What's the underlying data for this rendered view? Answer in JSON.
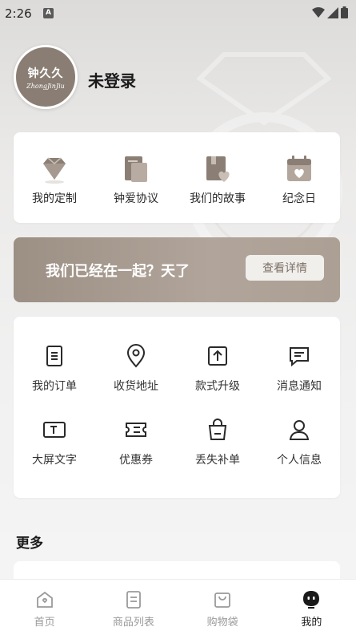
{
  "status_bar": {
    "time": "2:26",
    "notification_letter": "A"
  },
  "profile": {
    "avatar_cn": "钟久久",
    "avatar_en": "ZhongJinJiu",
    "login_label": "未登录"
  },
  "top_menu": [
    {
      "label": "我的定制",
      "icon": "diamond-icon"
    },
    {
      "label": "钟爱协议",
      "icon": "document-icon"
    },
    {
      "label": "我们的故事",
      "icon": "book-heart-icon"
    },
    {
      "label": "纪念日",
      "icon": "calendar-heart-icon"
    }
  ],
  "banner": {
    "text": "我们已经在一起？天了",
    "button": "查看详情"
  },
  "services": [
    {
      "label": "我的订单",
      "icon": "order-icon"
    },
    {
      "label": "收货地址",
      "icon": "location-pin-icon"
    },
    {
      "label": "款式升级",
      "icon": "upgrade-icon"
    },
    {
      "label": "消息通知",
      "icon": "message-icon"
    },
    {
      "label": "大屏文字",
      "icon": "text-screen-icon"
    },
    {
      "label": "优惠券",
      "icon": "coupon-icon"
    },
    {
      "label": "丢失补单",
      "icon": "bag-icon"
    },
    {
      "label": "个人信息",
      "icon": "person-icon"
    }
  ],
  "more": {
    "title": "更多"
  },
  "tabbar": [
    {
      "label": "首页",
      "icon": "home-icon",
      "active": false
    },
    {
      "label": "商品列表",
      "icon": "list-icon",
      "active": false
    },
    {
      "label": "购物袋",
      "icon": "shopping-bag-icon",
      "active": false
    },
    {
      "label": "我的",
      "icon": "profile-icon",
      "active": true
    }
  ],
  "colors": {
    "accent": "#9c8f84",
    "banner_button_text": "#7d7066"
  }
}
